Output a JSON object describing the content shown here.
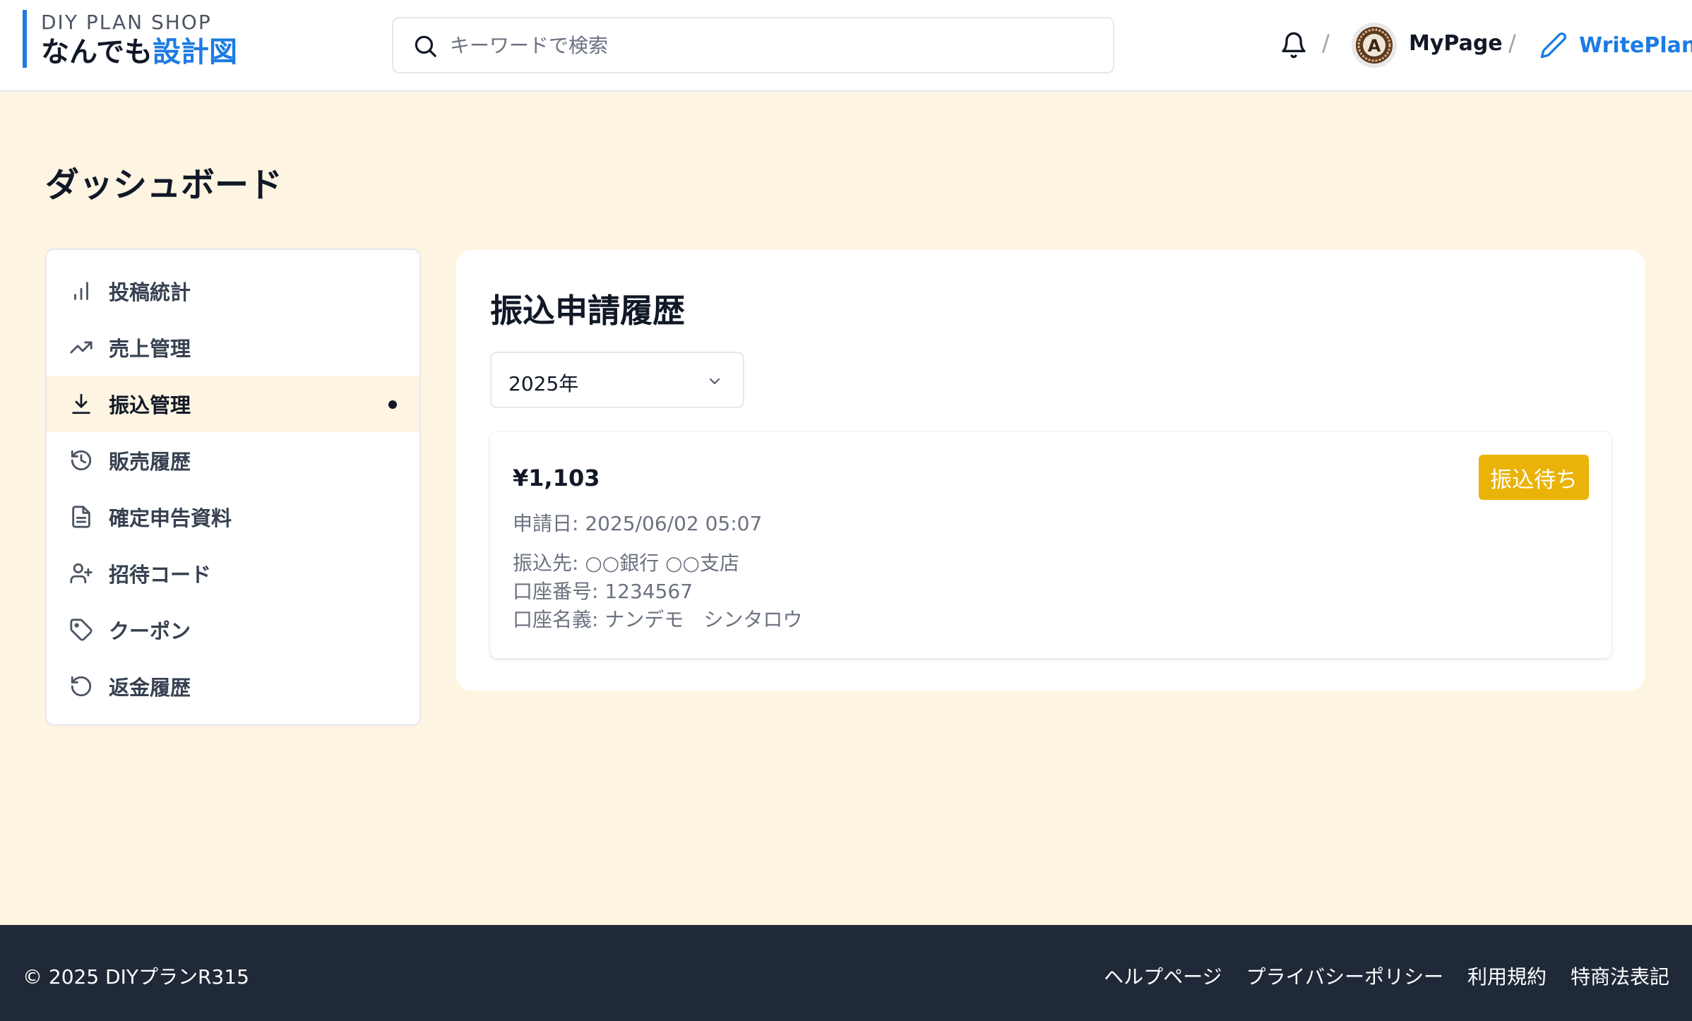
{
  "header": {
    "logo_sub": "DIY PLAN SHOP",
    "logo_main": "なんでも",
    "logo_accent": "設計図",
    "search_placeholder": "キーワードで検索",
    "separator": "/",
    "mypage_label": "MyPage",
    "writeplan_label": "WritePlan",
    "avatar_letter": "A"
  },
  "page": {
    "title": "ダッシュボード"
  },
  "sidebar": {
    "items": [
      {
        "label": "投稿統計",
        "icon": "bar-chart-icon"
      },
      {
        "label": "売上管理",
        "icon": "trending-up-icon"
      },
      {
        "label": "振込管理",
        "icon": "download-icon",
        "active": true
      },
      {
        "label": "販売履歴",
        "icon": "history-icon"
      },
      {
        "label": "確定申告資料",
        "icon": "document-icon"
      },
      {
        "label": "招待コード",
        "icon": "user-plus-icon"
      },
      {
        "label": "クーポン",
        "icon": "tag-icon"
      },
      {
        "label": "返金履歴",
        "icon": "rotate-ccw-icon"
      }
    ]
  },
  "main": {
    "title": "振込申請履歴",
    "year_select": "2025年",
    "request": {
      "amount": "¥1,103",
      "status": "振込待ち",
      "date": "申請日: 2025/06/02 05:07",
      "bank": "振込先: ○○銀行 ○○支店",
      "account_number": "口座番号: 1234567",
      "account_name": "口座名義: ナンデモ　シンタロウ"
    }
  },
  "footer": {
    "copyright": "© 2025 DIYプランR315",
    "links": [
      "ヘルプページ",
      "プライバシーポリシー",
      "利用規約",
      "特商法表記"
    ]
  },
  "colors": {
    "accent": "#1d7be3",
    "background": "#fef4e2",
    "badge": "#eab308",
    "footer": "#1f2937"
  }
}
